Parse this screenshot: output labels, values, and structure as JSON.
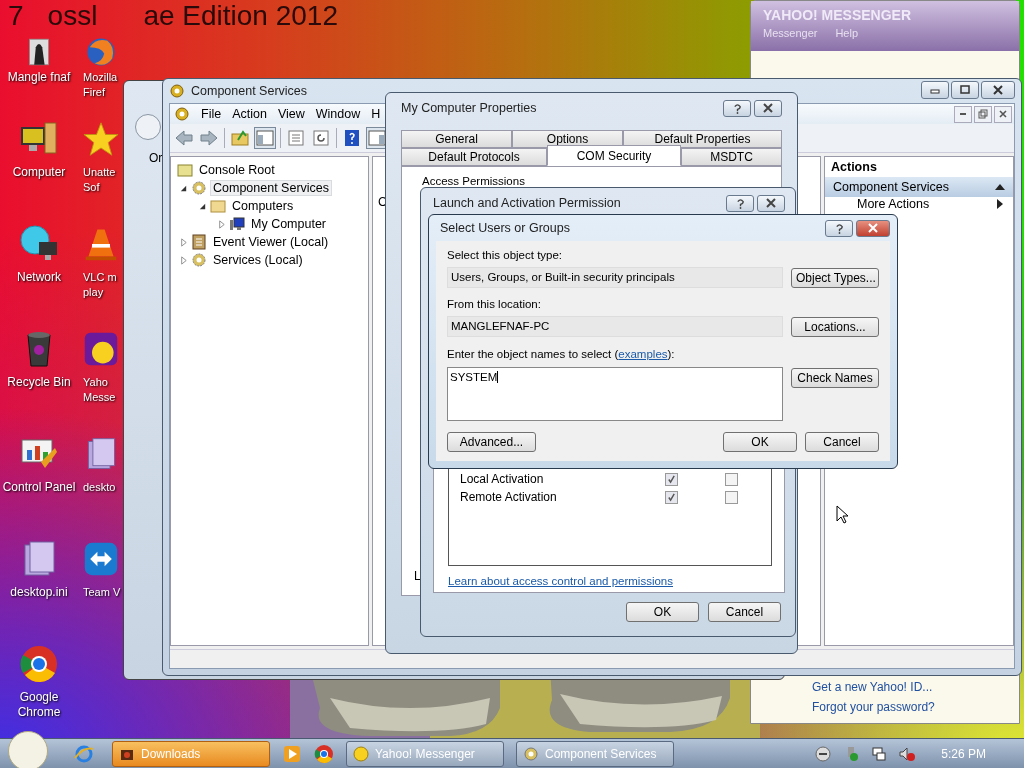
{
  "desktop": {
    "wallpaper_text": [
      "7",
      "ossl",
      "ae Edition 2012"
    ],
    "icons": [
      {
        "kind": "figure",
        "lines": [
          "Mangle fnaf"
        ]
      },
      {
        "kind": "computer",
        "lines": [
          "Computer"
        ]
      },
      {
        "kind": "globe",
        "lines": [
          "Network"
        ]
      },
      {
        "kind": "bin",
        "lines": [
          "Recycle Bin"
        ]
      },
      {
        "kind": "panel",
        "lines": [
          "Control Panel"
        ]
      },
      {
        "kind": "file",
        "lines": [
          "desktop.ini"
        ]
      },
      {
        "kind": "chrome",
        "lines": [
          "Google",
          "Chrome"
        ]
      }
    ],
    "icons_column_2": [
      {
        "kind": "firefox",
        "lines": [
          "Mozilla",
          "Firef"
        ]
      },
      {
        "kind": "star",
        "lines": [
          "Unatte",
          "Sof"
        ]
      },
      {
        "kind": "cone",
        "lines": [
          "VLC m",
          "play"
        ]
      },
      {
        "kind": "yahoo",
        "lines": [
          "Yaho",
          "Messe"
        ]
      },
      {
        "kind": "file",
        "lines": [
          "deskto"
        ]
      },
      {
        "kind": "arrows",
        "lines": [
          "Team V"
        ]
      }
    ]
  },
  "messenger_window": {
    "logo": "YAHOO! MESSENGER",
    "menu": [
      "Messenger",
      "Help"
    ],
    "links": [
      "Get a new Yahoo! ID...",
      "Forgot your password?"
    ]
  },
  "back_window": {
    "text": "Or"
  },
  "component_services": {
    "title": "Component Services",
    "menu": [
      "File",
      "Action",
      "View",
      "Window",
      "H"
    ],
    "tree_root": "Console Root",
    "tree": [
      {
        "label": "Component Services",
        "kind": "gear",
        "selected": true,
        "expanded": true,
        "children": [
          {
            "label": "Computers",
            "kind": "folder",
            "selected": false,
            "expanded": true,
            "children": [
              {
                "label": "My Computer",
                "kind": "pc",
                "selected": false,
                "expanded": false
              }
            ]
          }
        ]
      },
      {
        "label": "Event Viewer (Local)",
        "kind": "log",
        "selected": false,
        "expanded": false
      },
      {
        "label": "Services (Local)",
        "kind": "gear",
        "selected": false,
        "expanded": false
      }
    ],
    "middle_text": "C",
    "actions": {
      "title": "Actions",
      "section": "Component Services",
      "items": [
        "More Actions"
      ]
    }
  },
  "properties": {
    "title": "My Computer Properties",
    "tab_rows": [
      [
        {
          "label": "General",
          "selected": false
        },
        {
          "label": "Options",
          "selected": false
        },
        {
          "label": "Default Properties",
          "selected": false
        }
      ],
      [
        {
          "label": "Default Protocols",
          "selected": false
        },
        {
          "label": "COM Security",
          "selected": true
        },
        {
          "label": "MSDTC",
          "selected": false
        }
      ]
    ],
    "group_label": "Access Permissions",
    "lower_text": "L"
  },
  "launch": {
    "title": "Launch and Activation Permission",
    "permissions": [
      {
        "name": "Local Activation",
        "allow": true,
        "deny": false
      },
      {
        "name": "Remote Activation",
        "allow": true,
        "deny": false
      }
    ],
    "link": "Learn about access control and permissions",
    "buttons": [
      "OK",
      "Cancel"
    ]
  },
  "select_dialog": {
    "title": "Select Users or Groups",
    "object_type_label": "Select this object type:",
    "object_type": "Users, Groups, or Built-in security principals",
    "object_types_button": "Object Types...",
    "location_label": "From this location:",
    "location": "MANGLEFNAF-PC",
    "locations_button": "Locations...",
    "names_label": "Enter the object names to select (",
    "names_link": "examples",
    "names_label_end": "):",
    "names_value": "SYSTEM",
    "check_names_button": "Check Names",
    "advanced_button": "Advanced...",
    "buttons": [
      "OK",
      "Cancel"
    ]
  },
  "taskbar": {
    "buttons": [
      {
        "label": "Downloads",
        "kind": "folder",
        "selected": true
      },
      {
        "label": "Yahoo! Messenger",
        "kind": "yahoo",
        "selected": false
      },
      {
        "label": "Component Services",
        "kind": "gear",
        "selected": false
      }
    ],
    "clock": "5:26 PM"
  }
}
